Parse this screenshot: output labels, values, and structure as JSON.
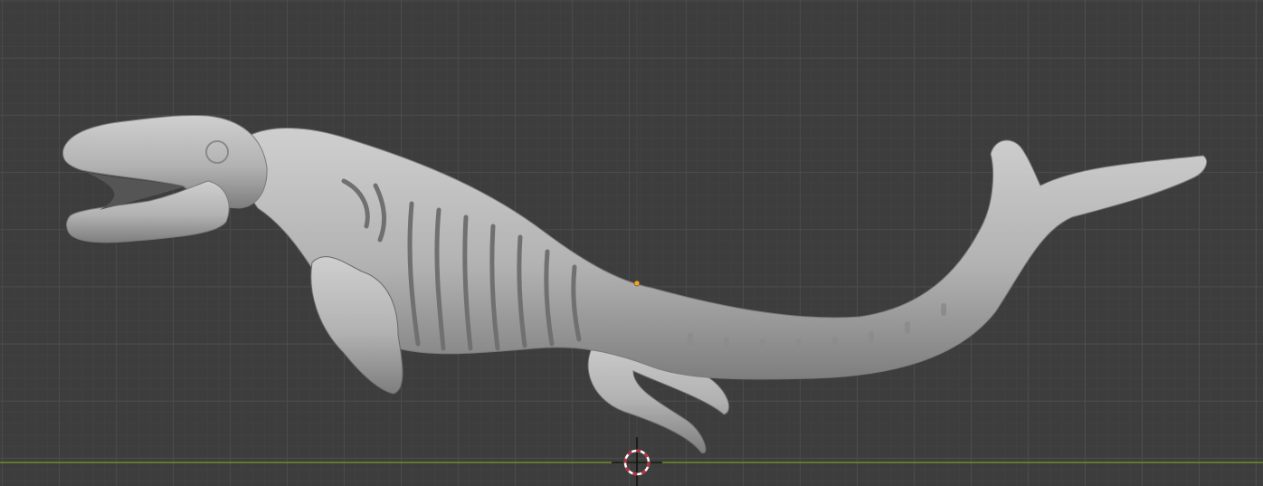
{
  "viewport": {
    "background_color": "#3d3d3d",
    "grid_color": "#4b4b4b",
    "x_axis_color": "#6b8e23",
    "model_color": "#b4b4b4",
    "origin_color": "#f5a623",
    "cursor_colors": [
      "#c8283c",
      "#ffffff"
    ]
  }
}
